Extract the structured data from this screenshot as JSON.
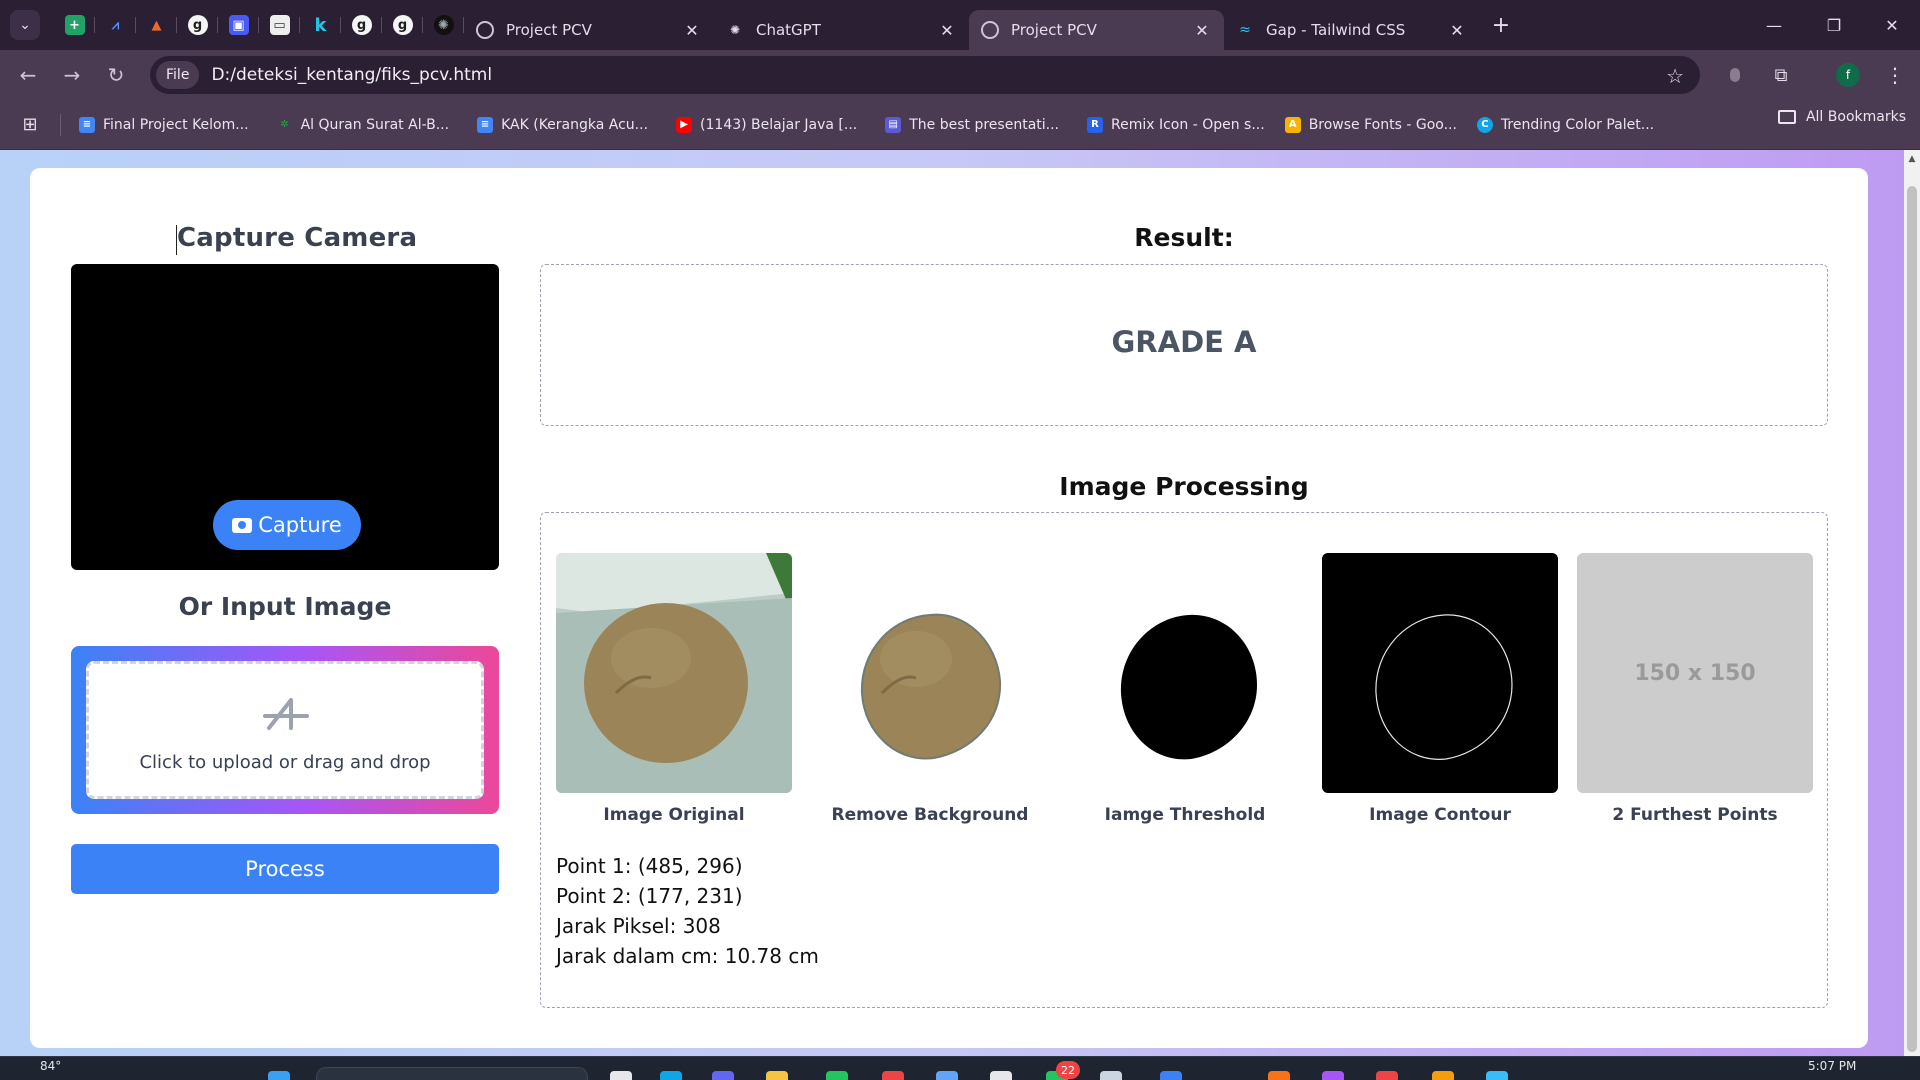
{
  "browser": {
    "pinned_tabs": [
      {
        "icon": "google-sheets-icon",
        "glyph": "+",
        "color": "#21a366"
      },
      {
        "icon": "ai-app-icon",
        "glyph": "⩘",
        "color": "#1f6feb"
      },
      {
        "icon": "matlab-icon",
        "glyph": "▲",
        "color": "#e8692a"
      },
      {
        "icon": "grammarly-icon",
        "glyph": "g",
        "color": "#2d2d2d"
      },
      {
        "icon": "app-icon",
        "glyph": "▣",
        "color": "#4a5af6"
      },
      {
        "icon": "web-page-icon",
        "glyph": "▭",
        "color": "#eeeeee"
      },
      {
        "icon": "k-icon",
        "glyph": "k",
        "color": "#2b1f33"
      },
      {
        "icon": "grammarly-icon",
        "glyph": "g",
        "color": "#2d2d2d"
      },
      {
        "icon": "grammarly-icon",
        "glyph": "g",
        "color": "#2d2d2d"
      },
      {
        "icon": "openai-icon",
        "glyph": "✺",
        "color": "#111111"
      }
    ],
    "tabs": [
      {
        "title": "Project PCV",
        "icon": "globe-icon",
        "active": false
      },
      {
        "title": "ChatGPT",
        "icon": "openai-icon",
        "active": false
      },
      {
        "title": "Project PCV",
        "icon": "globe-icon",
        "active": true
      },
      {
        "title": "Gap - Tailwind CSS",
        "icon": "tailwind-icon",
        "active": false
      }
    ],
    "new_tab": "+",
    "window_controls": {
      "minimize": "—",
      "maximize": "❐",
      "close": "✕"
    },
    "address": {
      "chip_label": "File",
      "url": "D:/deteksi_kentang/fiks_pcv.html"
    },
    "profile_initial": "f",
    "bookmarks": [
      {
        "label": "Final Project Kelom...",
        "icon": "google-docs-icon",
        "color": "#4285f4"
      },
      {
        "label": "Al Quran Surat Al-B...",
        "icon": "leaf-icon",
        "color": "#2e9e44"
      },
      {
        "label": "KAK (Kerangka Acu...",
        "icon": "google-docs-icon",
        "color": "#4285f4"
      },
      {
        "label": "(1143) Belajar Java [...",
        "icon": "youtube-icon",
        "color": "#ff0000"
      },
      {
        "label": "The best presentati...",
        "icon": "presentation-icon",
        "color": "#5b5bd6"
      },
      {
        "label": "Remix Icon - Open s...",
        "icon": "remix-icon",
        "color": "#2563eb"
      },
      {
        "label": "Browse Fonts - Goo...",
        "icon": "google-fonts-icon",
        "color": "#f4b400"
      },
      {
        "label": "Trending Color Palet...",
        "icon": "coolors-icon",
        "color": "#0ea5e9"
      }
    ],
    "all_bookmarks": "All Bookmarks"
  },
  "page": {
    "capture_title": "Capture Camera",
    "capture_button": "Capture",
    "input_title": "Or Input Image",
    "dropzone_text": "Click to upload or drag and drop",
    "process_button": "Process",
    "result_title": "Result:",
    "grade": "GRADE A",
    "processing_title": "Image Processing",
    "images": [
      {
        "label": "Image Original"
      },
      {
        "label": "Remove Background"
      },
      {
        "label": "Iamge Threshold"
      },
      {
        "label": "Image Contour"
      },
      {
        "label": "2 Furthest Points",
        "placeholder": "150 x 150"
      }
    ],
    "info_lines": [
      "Point 1: (485, 296)",
      "Point 2: (177, 231)",
      "Jarak Piksel: 308",
      "Jarak dalam cm: 10.78 cm"
    ]
  },
  "taskbar": {
    "weather": "84°",
    "badge": "22",
    "time": "5:07 PM"
  },
  "colors": {
    "accent": "#3b82f6",
    "potato": "#9a8458",
    "placeholder_bg": "#cccccc"
  }
}
